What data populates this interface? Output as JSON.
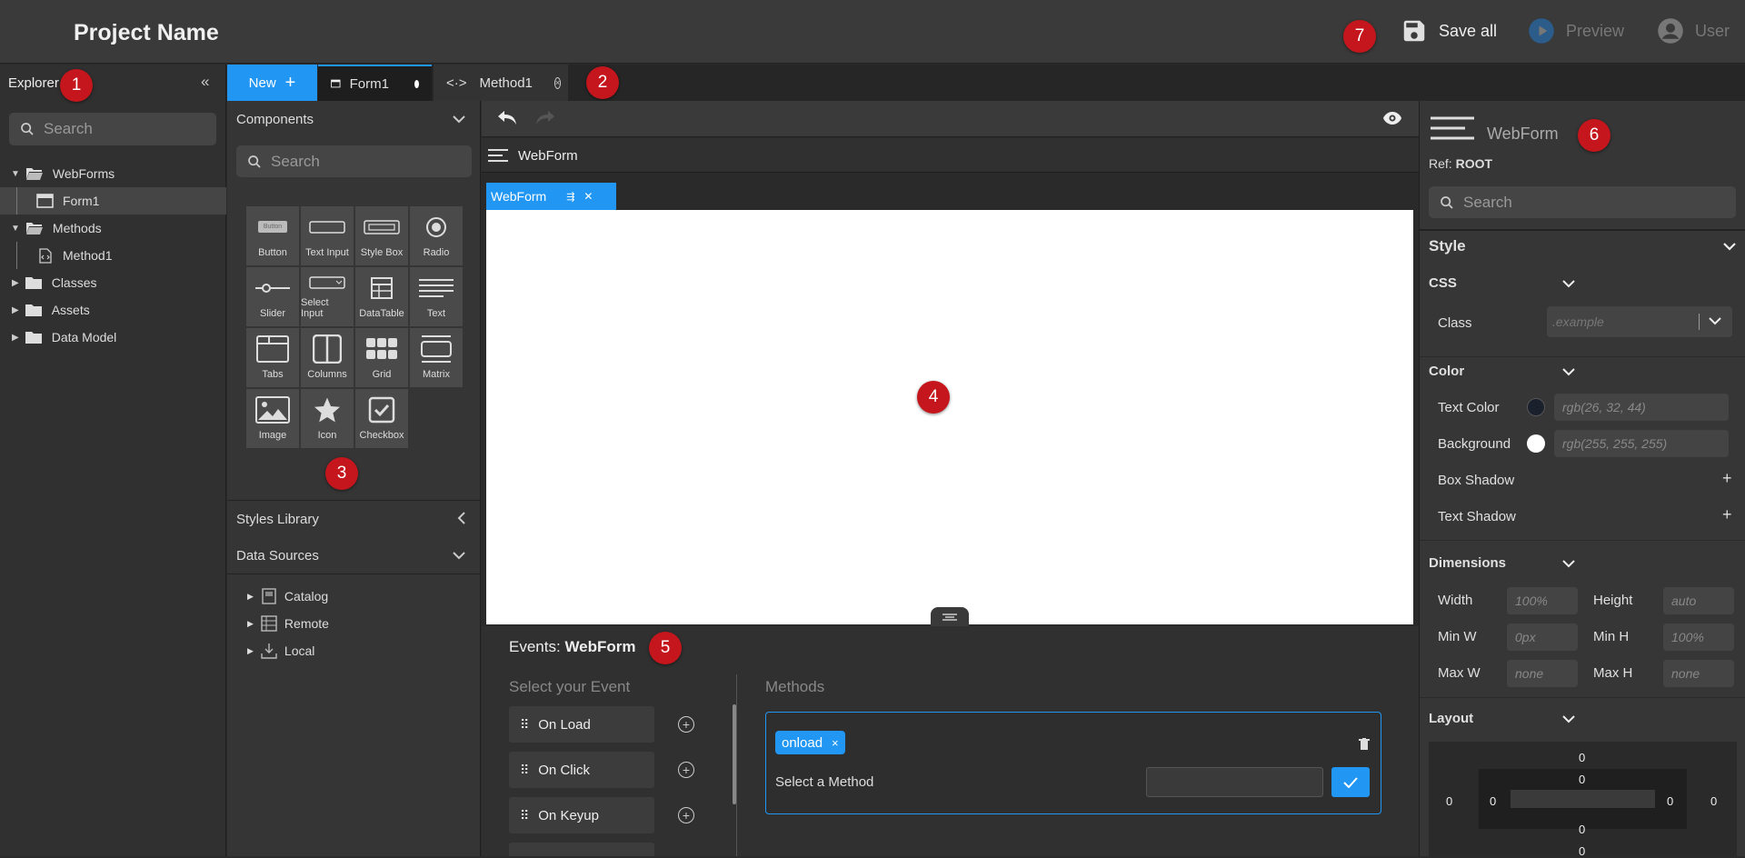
{
  "header": {
    "project_name": "Project Name",
    "save_all": "Save all",
    "preview": "Preview",
    "user": "User"
  },
  "badges": [
    "1",
    "2",
    "3",
    "4",
    "5",
    "6",
    "7"
  ],
  "explorer": {
    "title": "Explorer",
    "collapse": "«",
    "search_placeholder": "Search",
    "tree": [
      {
        "label": "WebForms",
        "type": "folder-open"
      },
      {
        "label": "Form1",
        "type": "form"
      },
      {
        "label": "Methods",
        "type": "folder-open"
      },
      {
        "label": "Method1",
        "type": "method"
      },
      {
        "label": "Classes",
        "type": "folder"
      },
      {
        "label": "Assets",
        "type": "folder"
      },
      {
        "label": "Data Model",
        "type": "folder"
      }
    ]
  },
  "tabs": {
    "new_label": "New",
    "items": [
      {
        "label": "Form1",
        "status": "unsaved"
      },
      {
        "label": "Method1",
        "status": "closable"
      }
    ]
  },
  "components": {
    "title": "Components",
    "search_placeholder": "Search",
    "items": [
      "Button",
      "Text Input",
      "Style Box",
      "Radio",
      "Slider",
      "Select Input",
      "DataTable",
      "Text",
      "Tabs",
      "Columns",
      "Grid",
      "Matrix",
      "Image",
      "Icon",
      "Checkbox"
    ],
    "button_preview_text": "Button",
    "styles_library": "Styles Library",
    "data_sources": "Data Sources",
    "sources": [
      "Catalog",
      "Remote",
      "Local"
    ]
  },
  "canvas": {
    "breadcrumb": "WebForm",
    "selected_chip": "WebForm"
  },
  "events": {
    "title_prefix": "Events:",
    "title_target": "WebForm",
    "select_event_label": "Select your Event",
    "list": [
      "On Load",
      "On Click",
      "On Keyup"
    ],
    "methods_label": "Methods",
    "tag": "onload",
    "select_method_label": "Select a Method"
  },
  "properties": {
    "title": "WebForm",
    "ref_label": "Ref:",
    "ref_value": "ROOT",
    "search_placeholder": "Search",
    "style_label": "Style",
    "css_label": "CSS",
    "class_label": "Class",
    "class_placeholder": ".example",
    "color_label": "Color",
    "text_color_label": "Text Color",
    "text_color_value": "rgb(26, 32, 44)",
    "background_label": "Background",
    "background_value": "rgb(255, 255, 255)",
    "box_shadow_label": "Box Shadow",
    "text_shadow_label": "Text Shadow",
    "dimensions_label": "Dimensions",
    "width_label": "Width",
    "width_value": "100%",
    "height_label": "Height",
    "height_value": "auto",
    "minw_label": "Min W",
    "minw_value": "0px",
    "minh_label": "Min H",
    "minh_value": "100%",
    "maxw_label": "Max W",
    "maxw_value": "none",
    "maxh_label": "Max H",
    "maxh_value": "none",
    "layout_label": "Layout",
    "box_values": {
      "margin_top": "0",
      "padding_top": "0",
      "padding_bottom": "0",
      "margin_bottom": "0",
      "margin_left": "0",
      "padding_left": "0",
      "padding_right": "0",
      "margin_right": "0"
    }
  },
  "colors": {
    "accent": "#2196f3",
    "badge": "#c4161c",
    "text_color_swatch": "#1a202c",
    "background_swatch": "#ffffff"
  }
}
